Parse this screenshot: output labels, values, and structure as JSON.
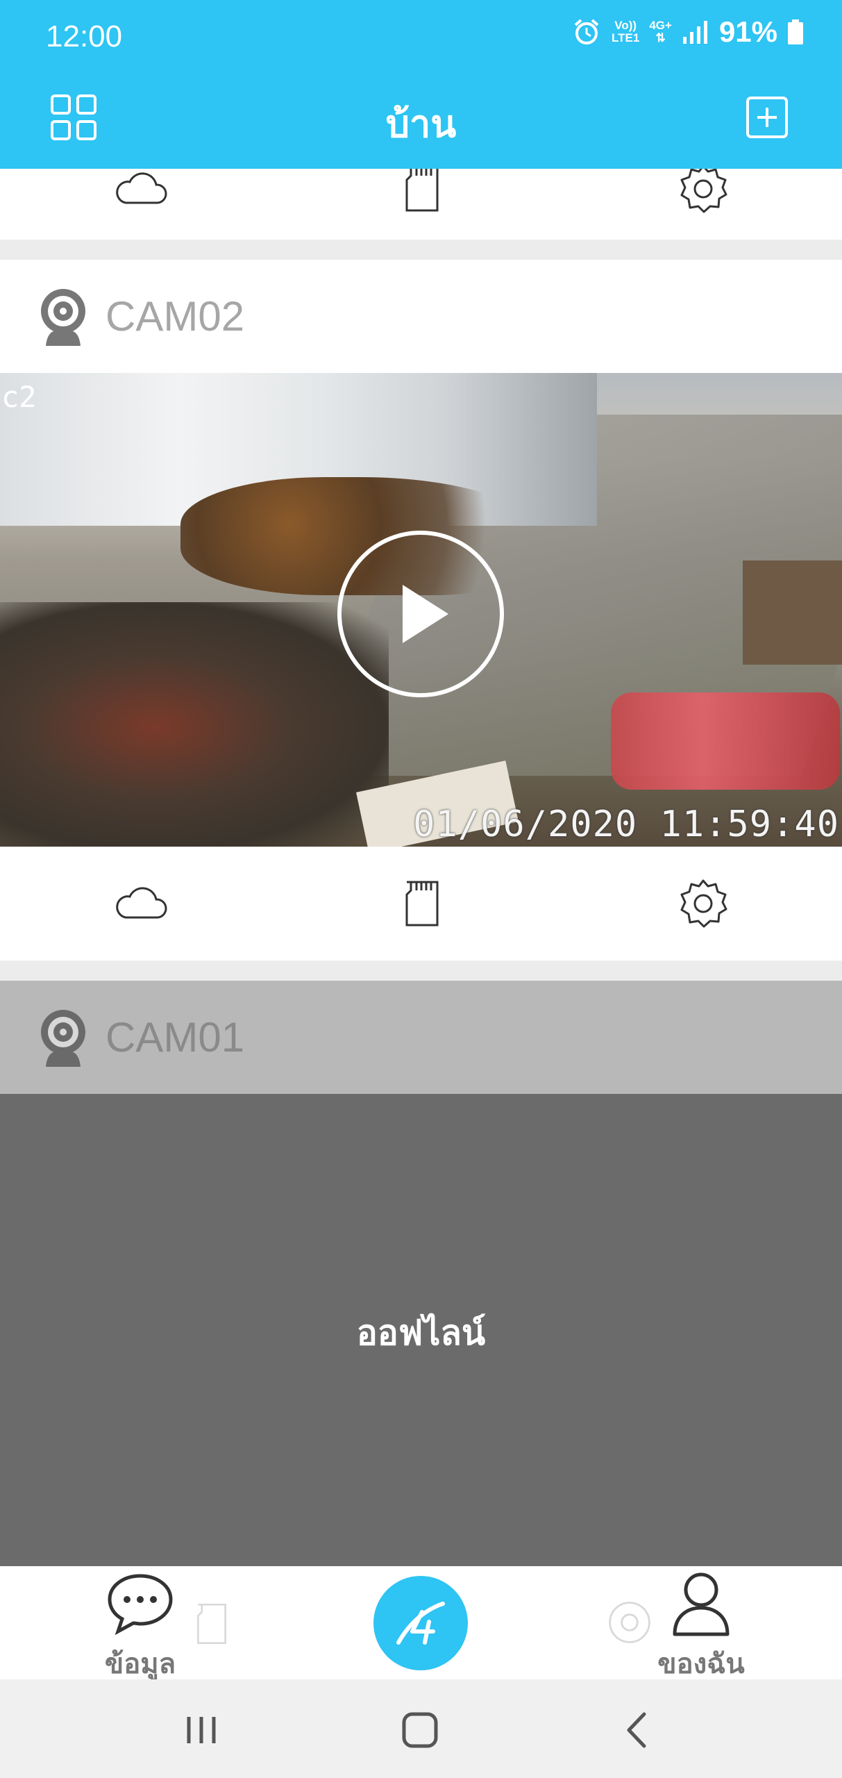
{
  "status_bar": {
    "time": "12:00",
    "volte": "Vo))",
    "lte": "LTE1",
    "network": "4G+",
    "battery": "91%",
    "icons": [
      "alarm-icon",
      "signal-icon",
      "battery-icon"
    ]
  },
  "header": {
    "title": "บ้าน",
    "left_icon": "grid-icon",
    "right_icon": "add-square-icon"
  },
  "cameras": [
    {
      "name": "CAM02",
      "overlay_tag": "c2",
      "timestamp": "01/06/2020 11:59:40",
      "play_icon": "play-circle-icon"
    },
    {
      "name": "CAM01",
      "status": "ออฟไลน์"
    }
  ],
  "card_actions": [
    "cloud-icon",
    "sd-card-icon",
    "settings-icon"
  ],
  "bottom_nav": {
    "left_label": "ข้อมูล",
    "right_label": "ของฉัน",
    "left_icon": "chat-bubble-icon",
    "center_icon": "app-logo-icon",
    "right_icon": "user-icon"
  },
  "colors": {
    "primary": "#2ec4f3",
    "offline_bg": "#6b6b6b",
    "offline_header": "#b8b8b8"
  }
}
